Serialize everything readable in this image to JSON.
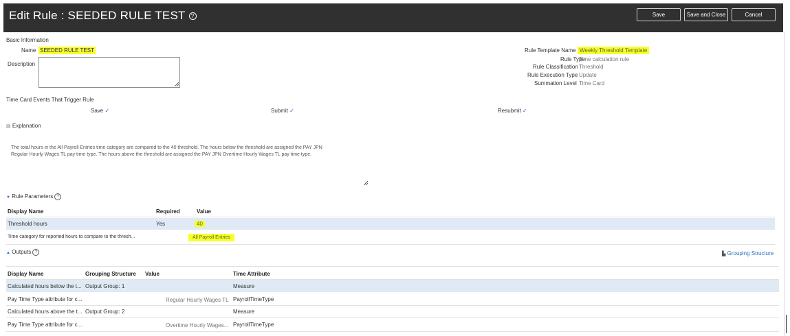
{
  "header": {
    "title": "Edit Rule : SEEDED RULE TEST",
    "save_label": "Save",
    "save_close_label": "Save and Close",
    "cancel_label": "Cancel"
  },
  "basic": {
    "section_label": "Basic Information",
    "name_label": "Name",
    "name_value": "SEEDED RULE TEST",
    "description_label": "Description",
    "description_value": "",
    "template_label": "Rule Template Name",
    "template_value": "Weekly Threshold Template",
    "rule_type_label": "Rule Type",
    "rule_type_value": "Time calculation rule",
    "classification_label": "Rule Classification",
    "classification_value": "Threshold",
    "execution_label": "Rule Execution Type",
    "execution_value": "Update",
    "summation_label": "Summation Level",
    "summation_value": "Time Card"
  },
  "events": {
    "section_label": "Time Card Events That Trigger Rule",
    "save_label": "Save",
    "submit_label": "Submit",
    "resubmit_label": "Resubmit",
    "check": "✓"
  },
  "explanation": {
    "label": "Explanation",
    "line1": "The total hours in the All Payroll Entries time category are compared to the 40 threshold. The hours below the threshold are assigned the PAY JPN",
    "line2": "Regular Hourly Wages TL pay time type. The hours above the threshold are assigned the PAY JPN Overtime Hourly Wages TL pay time type."
  },
  "rule_parameters": {
    "label": "Rule Parameters",
    "columns": [
      "Display Name",
      "Required",
      "Value"
    ],
    "rows": [
      {
        "name": "Threshold hours",
        "required": "Yes",
        "value": "40"
      },
      {
        "name": "Time category for reported hours to compare to the thresh...",
        "required": "",
        "value": "All Payroll Entries"
      }
    ]
  },
  "outputs": {
    "label": "Outputs",
    "grouping_link": "Grouping Structure",
    "columns": [
      "Display Name",
      "Grouping Structure",
      "Value",
      "Time Attribute"
    ],
    "rows": [
      {
        "name": "Calculated hours below the t...",
        "group": "Output Group: 1",
        "value": "",
        "attr": "Measure"
      },
      {
        "name": "Pay Time Type attribute for c...",
        "group": "",
        "value": "Regular Hourly Wages TL",
        "attr": "PayrollTimeType"
      },
      {
        "name": "Calculated hours above the t...",
        "group": "Output Group: 2",
        "value": "",
        "attr": "Measure"
      },
      {
        "name": "Pay Time Type attribute for c...",
        "group": "",
        "value": "Overtime Hourly Wages...",
        "attr": "PayrollTimeType"
      }
    ]
  },
  "icons": {
    "help": "?",
    "triangle_down": "▼",
    "triangle_up": "▲",
    "explanation": "▤",
    "grouping": "▙"
  }
}
